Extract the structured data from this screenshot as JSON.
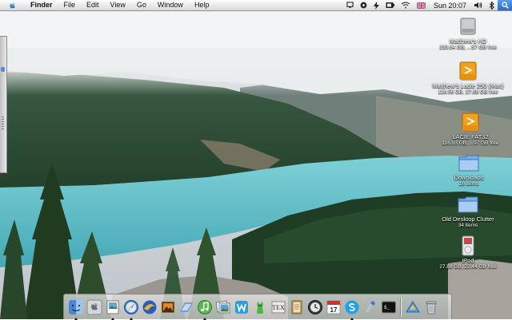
{
  "menubar": {
    "app_name": "Finder",
    "menus": [
      "File",
      "Edit",
      "View",
      "Go",
      "Window",
      "Help"
    ],
    "status_icons": [
      "display-icon",
      "sync-icon",
      "power-icon",
      "battery-icon",
      "wifi-icon",
      "flag-uk-icon"
    ],
    "clock": "Sun 20:07",
    "extra_icons": [
      "volume-icon",
      "bluetooth-icon",
      "spotlight-icon"
    ]
  },
  "desktop": {
    "icons": [
      {
        "name": "Matthew's HD",
        "detail": "233.64 GB, ...57 GB free",
        "icon": "hard-drive-icon"
      },
      {
        "name": "Matthew's Lacie 250 (Mac)",
        "detail": "116.56 GB, 27.88 GB free",
        "icon": "external-drive-icon"
      },
      {
        "name": "LACIE FAT32",
        "detail": "116.93 GB, ...97 GB free",
        "icon": "external-drive-icon"
      },
      {
        "name": "Downloads",
        "detail": "16 items",
        "icon": "folder-icon"
      },
      {
        "name": "Old Desktop Clutter",
        "detail": "34 items",
        "icon": "folder-icon"
      },
      {
        "name": "iPod",
        "detail": "27.88 GB, 22.44 GB free",
        "icon": "ipod-icon"
      }
    ]
  },
  "dock": {
    "items": [
      {
        "app": "Finder",
        "icon": "finder-icon",
        "running": true
      },
      {
        "app": "System Preferences",
        "icon": "apple-icon",
        "running": false
      },
      {
        "app": "Preview",
        "icon": "preview-icon",
        "running": true
      },
      {
        "app": "Safari",
        "icon": "safari-icon",
        "running": true
      },
      {
        "app": "Camino",
        "icon": "camino-icon",
        "running": false
      },
      {
        "app": "Photo",
        "icon": "photo-icon",
        "running": false
      },
      {
        "app": "Mail",
        "icon": "mail-icon",
        "running": false
      },
      {
        "app": "iTunes",
        "icon": "itunes-icon",
        "running": true
      },
      {
        "app": "iPhoto",
        "icon": "iphoto-icon",
        "running": false
      },
      {
        "app": "iWeb",
        "icon": "iweb-icon",
        "running": false
      },
      {
        "app": "Adium",
        "icon": "adium-icon",
        "running": false
      },
      {
        "app": "TeX",
        "icon": "tex-icon",
        "running": false
      },
      {
        "app": "Notes",
        "icon": "notes-icon",
        "running": false
      },
      {
        "app": "Time Machine",
        "icon": "time-machine-icon",
        "running": false
      },
      {
        "app": "iCal",
        "icon": "calendar-icon",
        "running": false
      },
      {
        "app": "Skype",
        "icon": "skype-icon",
        "running": true
      },
      {
        "app": "Utility",
        "icon": "utility-icon",
        "running": false
      },
      {
        "app": "Terminal",
        "icon": "terminal-icon",
        "running": false
      },
      {
        "app": "Applications",
        "icon": "applications-stack-icon",
        "running": false
      },
      {
        "app": "Trash",
        "icon": "trash-icon",
        "running": false
      }
    ],
    "calendar_day": "17",
    "tex_label": "TEX",
    "terminal_prompt": "$_"
  },
  "colors": {
    "lake": "#5fbfc9",
    "forest": "#1e3a22",
    "sky": "#d8dde0",
    "menubar": "#e6e6e6",
    "accent": "#3b78d4"
  }
}
